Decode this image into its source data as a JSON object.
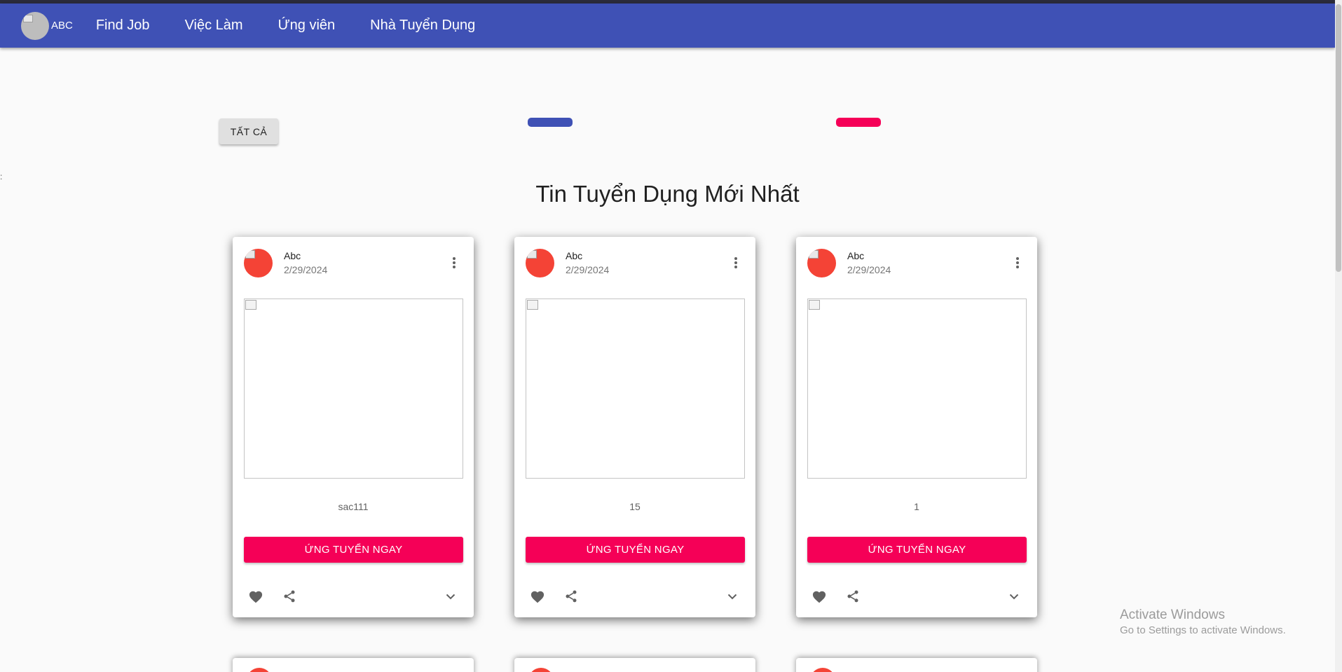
{
  "appbar": {
    "logo_text": "ABC",
    "nav": [
      "Find Job",
      "Việc Làm",
      "Ứng viên",
      "Nhà Tuyển Dụng"
    ]
  },
  "filters": {
    "all_label": "TẤT CẢ"
  },
  "section": {
    "title": "Tin Tuyển Dụng Mới Nhất"
  },
  "cards": [
    {
      "author": "Abc",
      "date": "2/29/2024",
      "content": "sac111",
      "apply_label": "ỨNG TUYỂN NGAY"
    },
    {
      "author": "Abc",
      "date": "2/29/2024",
      "content": "15",
      "apply_label": "ỨNG TUYỂN NGAY"
    },
    {
      "author": "Abc",
      "date": "2/29/2024",
      "content": "1",
      "apply_label": "ỨNG TUYỂN NGAY"
    }
  ],
  "watermark": {
    "title": "Activate Windows",
    "subtitle": "Go to Settings to activate Windows."
  },
  "icons": {
    "more": "more-vert-icon",
    "favorite": "heart-icon",
    "share": "share-icon",
    "expand": "chevron-down-icon"
  },
  "colors": {
    "primary": "#3f51b5",
    "secondary": "#f50057",
    "avatar": "#f44336"
  }
}
